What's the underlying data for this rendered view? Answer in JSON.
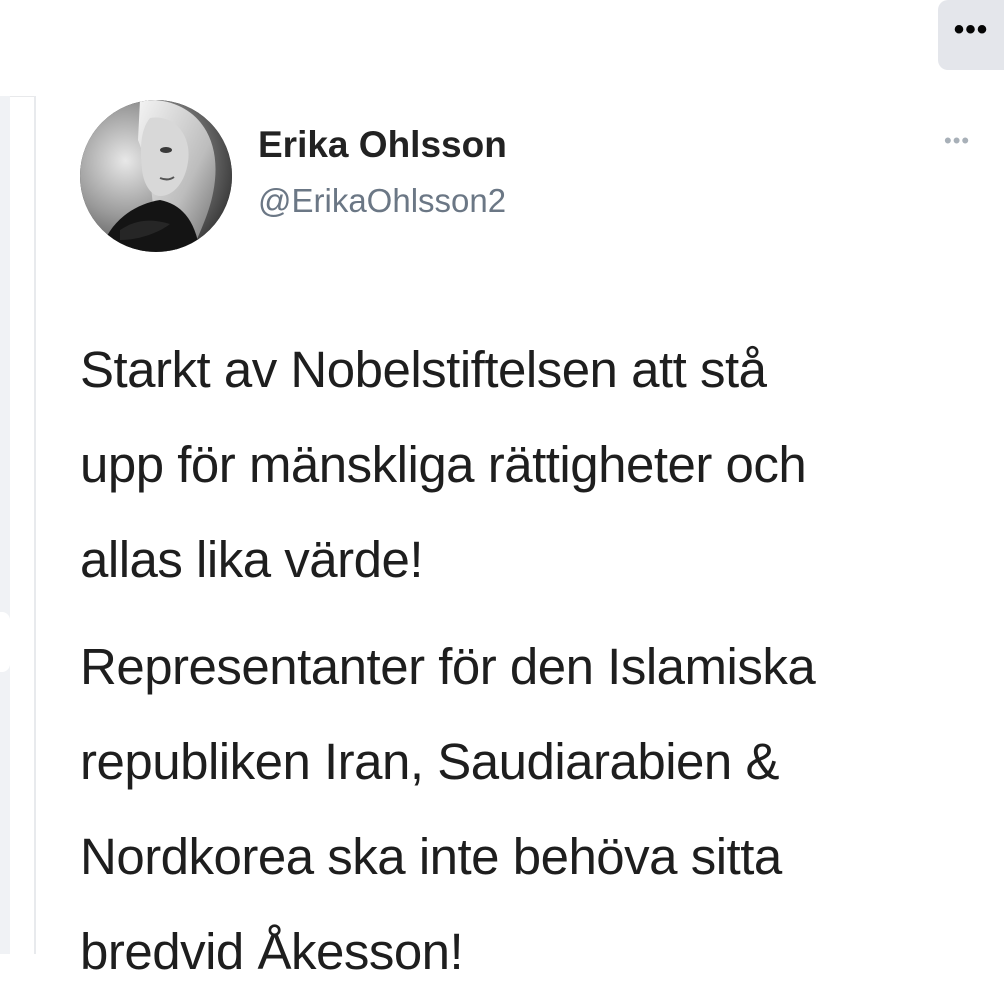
{
  "topbar": {
    "more_icon": "more-horizontal-icon",
    "more_label": "•••"
  },
  "tweet": {
    "author": {
      "name": "Erika Ohlsson",
      "handle": "@ErikaOhlsson2"
    },
    "more_label": "•••",
    "paragraphs": [
      {
        "lines": [
          "Starkt av Nobelstiftelsen att stå",
          "upp för mänskliga rättigheter och",
          "allas lika värde!"
        ]
      },
      {
        "lines": [
          "Representanter för den Islamiska",
          "republiken Iran, Saudiarabien &",
          "Nordkorea ska inte behöva sitta",
          "bredvid Åkesson!"
        ]
      }
    ]
  },
  "colors": {
    "top_button_bg": "#e4e6eb",
    "handle_text": "#6b7785",
    "name_text": "#222222",
    "body_text": "#1e1e1e"
  }
}
